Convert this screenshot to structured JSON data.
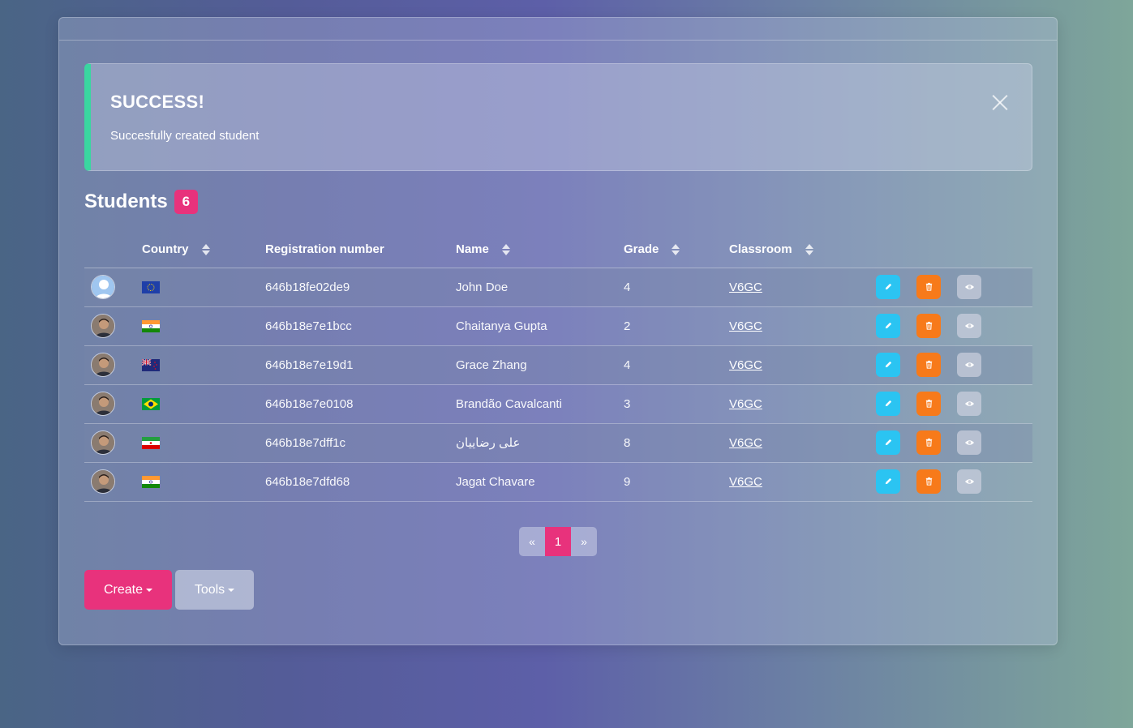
{
  "alert": {
    "title": "SUCCESS!",
    "message": "Succesfully created student"
  },
  "students_heading": {
    "title": "Students",
    "count": "6"
  },
  "table": {
    "columns": [
      "",
      "Country",
      "Registration number",
      "Name",
      "Grade",
      "Classroom",
      ""
    ],
    "sortable_columns": [
      "Country",
      "Name",
      "Grade",
      "Classroom"
    ],
    "rows": [
      {
        "avatar": "default-user-avatar",
        "country_flag": "eu-flag",
        "registration": "646b18fe02de9",
        "name": "John Doe",
        "grade": "4",
        "classroom": "V6GC"
      },
      {
        "avatar": "photo-avatar",
        "country_flag": "india-flag",
        "registration": "646b18e7e1bcc",
        "name": "Chaitanya Gupta",
        "grade": "2",
        "classroom": "V6GC"
      },
      {
        "avatar": "photo-avatar",
        "country_flag": "new-zealand-flag",
        "registration": "646b18e7e19d1",
        "name": "Grace Zhang",
        "grade": "4",
        "classroom": "V6GC"
      },
      {
        "avatar": "photo-avatar",
        "country_flag": "brazil-flag",
        "registration": "646b18e7e0108",
        "name": "Brandão Cavalcanti",
        "grade": "3",
        "classroom": "V6GC"
      },
      {
        "avatar": "photo-avatar",
        "country_flag": "iran-flag",
        "registration": "646b18e7dff1c",
        "name": "علی رضاییان",
        "grade": "8",
        "classroom": "V6GC"
      },
      {
        "avatar": "photo-avatar",
        "country_flag": "india-flag",
        "registration": "646b18e7dfd68",
        "name": "Jagat Chavare",
        "grade": "9",
        "classroom": "V6GC"
      }
    ],
    "row_actions": [
      "pencil-icon",
      "trash-icon",
      "eye-icon"
    ]
  },
  "pagination": {
    "prev": "«",
    "current": "1",
    "next": "»"
  },
  "buttons": {
    "create": "Create",
    "tools": "Tools"
  },
  "colors": {
    "accent": "#e8327c",
    "success_border": "#3ad6a0",
    "edit": "#2bc4f2",
    "delete": "#f77a1a"
  }
}
